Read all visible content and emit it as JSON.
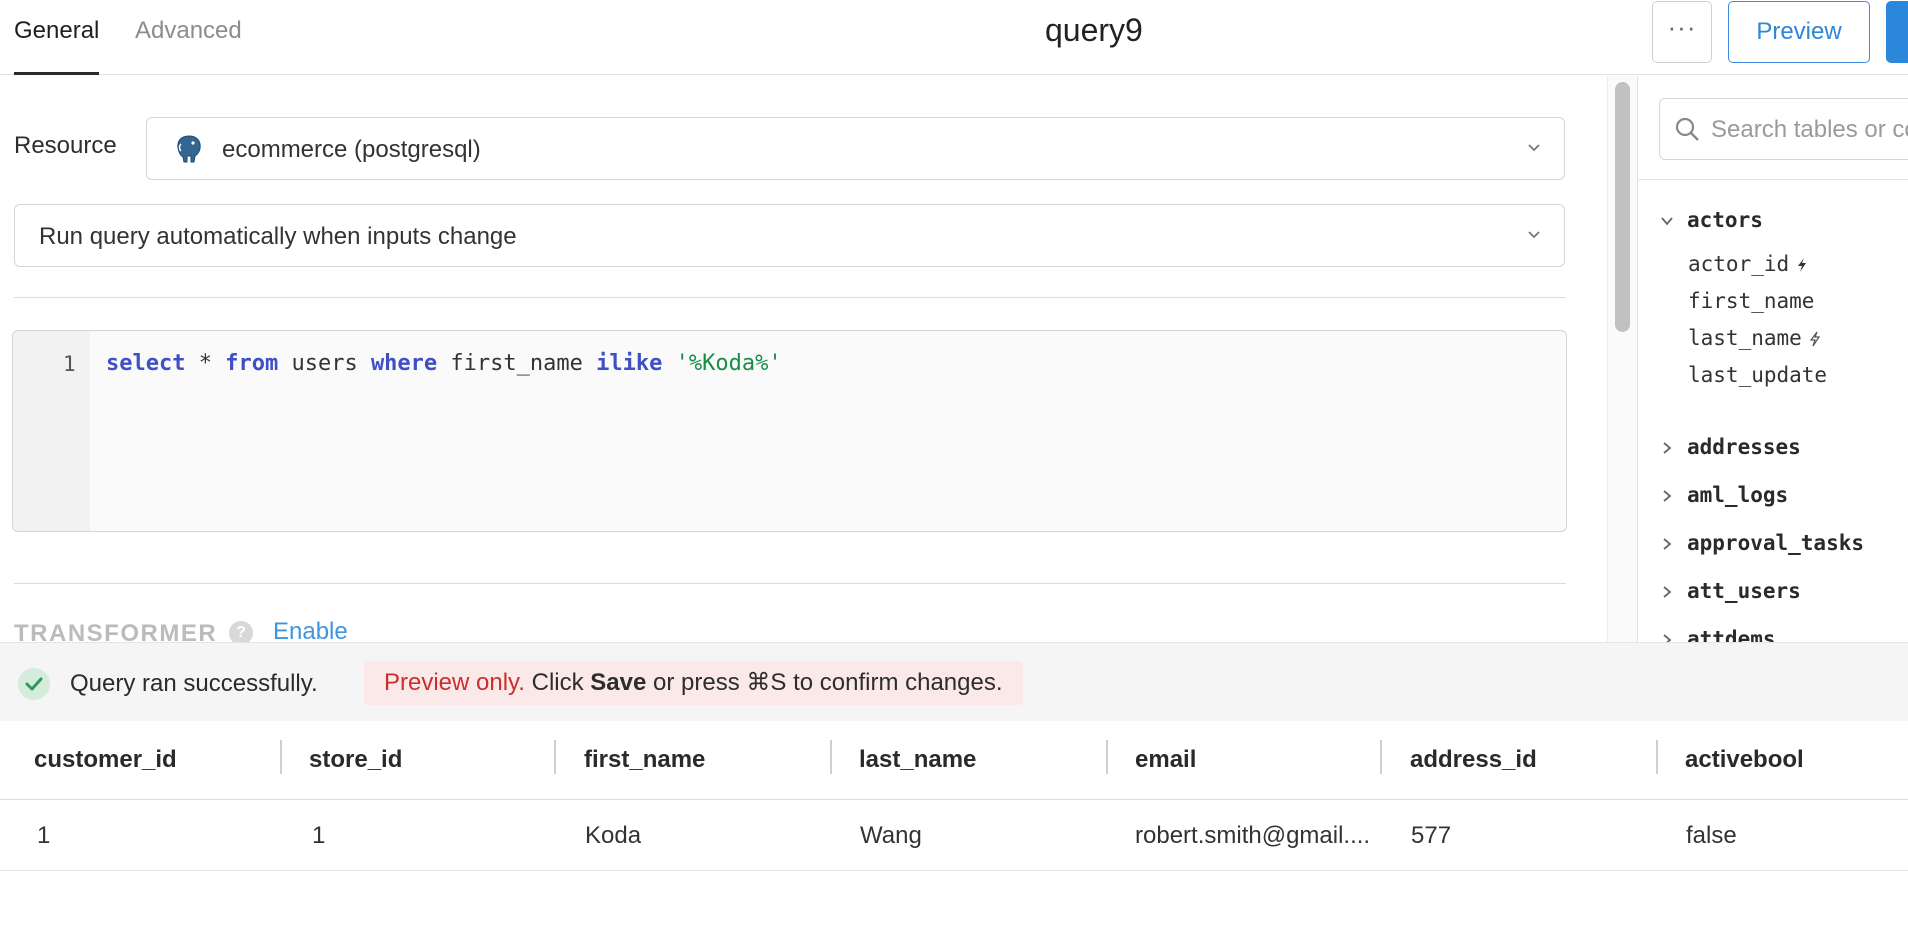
{
  "header": {
    "tabs": [
      {
        "label": "General",
        "active": true
      },
      {
        "label": "Advanced",
        "active": false
      }
    ],
    "title": "query9",
    "more_label": "···",
    "preview_label": "Preview"
  },
  "form": {
    "resource_label": "Resource",
    "resource_value": "ecommerce (postgresql)",
    "resource_icon": "postgresql-elephant-icon",
    "run_mode": "Run query automatically when inputs change"
  },
  "editor": {
    "line_number": "1",
    "tokens": {
      "select": "select",
      "star": " * ",
      "from": "from",
      "table": " users ",
      "where": "where",
      "column": " first_name ",
      "op": "ilike",
      "space": " ",
      "literal": "'%Koda%'"
    }
  },
  "transformer": {
    "label": "TRANSFORMER",
    "help": "?",
    "enable_label": "Enable"
  },
  "schema": {
    "search_placeholder": "Search tables or columns",
    "tables": [
      {
        "name": "actors",
        "expanded": true,
        "columns": [
          {
            "name": "actor_id",
            "key": "primary"
          },
          {
            "name": "first_name",
            "key": ""
          },
          {
            "name": "last_name",
            "key": "secondary"
          },
          {
            "name": "last_update",
            "key": ""
          }
        ]
      },
      {
        "name": "addresses",
        "expanded": false
      },
      {
        "name": "aml_logs",
        "expanded": false
      },
      {
        "name": "approval_tasks",
        "expanded": false
      },
      {
        "name": "att_users",
        "expanded": false
      },
      {
        "name": "attdems",
        "expanded": false
      }
    ]
  },
  "status": {
    "success_text": "Query ran successfully.",
    "preview_notice": {
      "warn": "Preview only.",
      "text1": " Click ",
      "save": "Save",
      "text2": " or press ⌘S to confirm changes."
    }
  },
  "results": {
    "columns": [
      "customer_id",
      "store_id",
      "first_name",
      "last_name",
      "email",
      "address_id",
      "activebool"
    ],
    "rows": [
      [
        "1",
        "1",
        "Koda",
        "Wang",
        "robert.smith@gmail....",
        "577",
        "false"
      ]
    ]
  },
  "colors": {
    "accent": "#2d86d8",
    "keyword": "#3f4fc4",
    "string": "#178d4a",
    "error_text": "#c9302c",
    "success_bg": "#d4ecdc"
  }
}
